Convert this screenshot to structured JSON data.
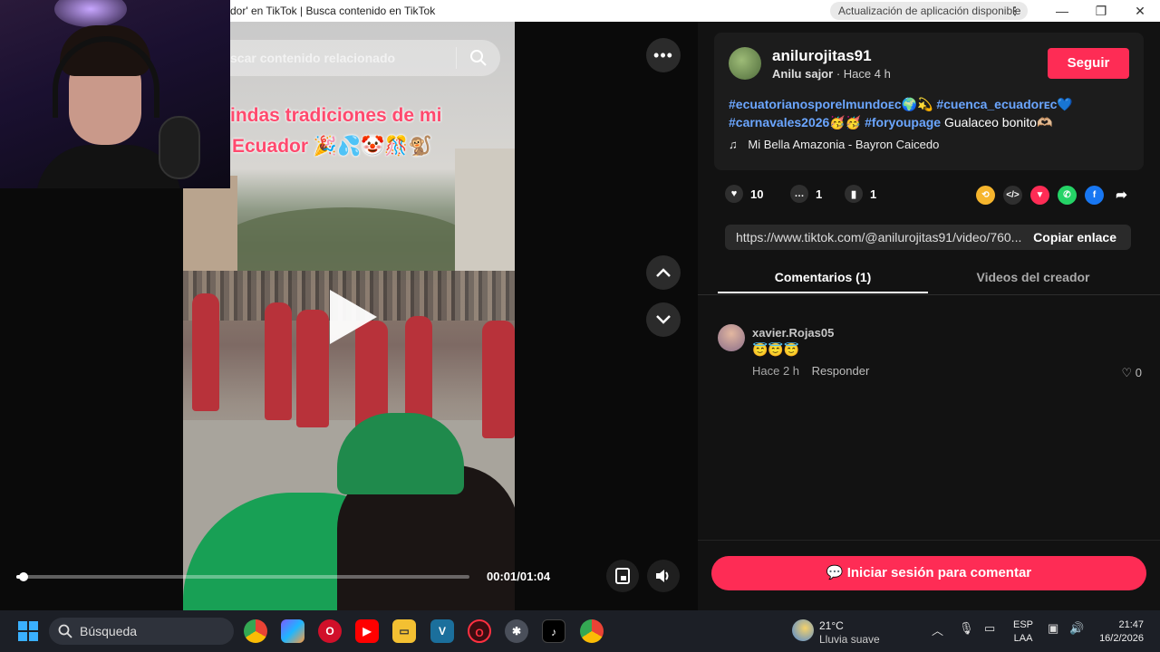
{
  "window": {
    "title": "dor' en TikTok | Busca contenido en TikTok",
    "update_notice": "Actualización de aplicación disponible",
    "minimize": "—",
    "restore": "❐",
    "close": "✕"
  },
  "video": {
    "search_placeholder": "scar contenido relacionado",
    "caption_line1": "indas tradiciones de mi",
    "caption_line2": "Ecuador 🎉💦🤡🎊🐒",
    "timecode": "00:01/01:04",
    "progress_fraction": 0.016
  },
  "post": {
    "username": "anilurojitas91",
    "display_name": "Anilu sajor",
    "time_ago": "Hace 4 h",
    "follow_label": "Seguir",
    "tags": [
      "#ecuatorianosporelmundoᴇᴄ🌍💫",
      "#cuenca_ecuadorᴇᴄ💙",
      "#carnavales2026🥳🥳",
      "#foryoupage"
    ],
    "desc_tail": "Gualaceo bonito🫶🏼",
    "music": "Mi Bella Amazonia - Bayron Caicedo",
    "likes": "10",
    "comments": "1",
    "saves": "1",
    "link_url": "https://www.tiktok.com/@anilurojitas91/video/760...",
    "copy_label": "Copiar enlace"
  },
  "tabs": {
    "comments": "Comentarios (1)",
    "creator_videos": "Videos del creador"
  },
  "comment": {
    "user": "xavier.Rojas05",
    "text": "😇😇😇",
    "time": "Hace 2 h",
    "reply": "Responder",
    "likes": "♡ 0"
  },
  "login_comment": "💬 Iniciar sesión para comentar",
  "taskbar": {
    "search": "Búsqueda",
    "temp": "21°C",
    "condition": "Lluvia suave",
    "lang1": "ESP",
    "lang2": "LAA",
    "time": "21:47",
    "date": "16/2/2026"
  },
  "colors": {
    "accent": "#fe2c55",
    "hashtag": "#6ba6ff",
    "panel": "#121212"
  }
}
